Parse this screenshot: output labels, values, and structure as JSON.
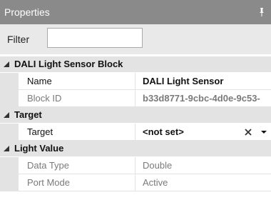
{
  "panel": {
    "title": "Properties",
    "pin_icon": "pin-icon"
  },
  "filter": {
    "label": "Filter",
    "value": ""
  },
  "categories": [
    {
      "label": "DALI Light Sensor Block",
      "rows": [
        {
          "name": "Name",
          "value": "DALI Light Sensor"
        },
        {
          "name": "Block ID",
          "value": "b33d8771-9cbc-4d0e-9c53-"
        }
      ]
    },
    {
      "label": "Target",
      "rows": [
        {
          "name": "Target",
          "value": "<not set>",
          "clear_icon": "clear-x-icon",
          "dropdown_icon": "dropdown-arrow-icon"
        }
      ]
    },
    {
      "label": "Light Value",
      "rows": [
        {
          "name": "Data Type",
          "value": "Double"
        },
        {
          "name": "Port Mode",
          "value": "Active"
        }
      ]
    }
  ],
  "colors": {
    "titlebar": "#8a8a8a",
    "category_bg": "#e3e3e3",
    "filter_bg": "#e9e9e9",
    "disabled_text": "#7a7a7a"
  }
}
